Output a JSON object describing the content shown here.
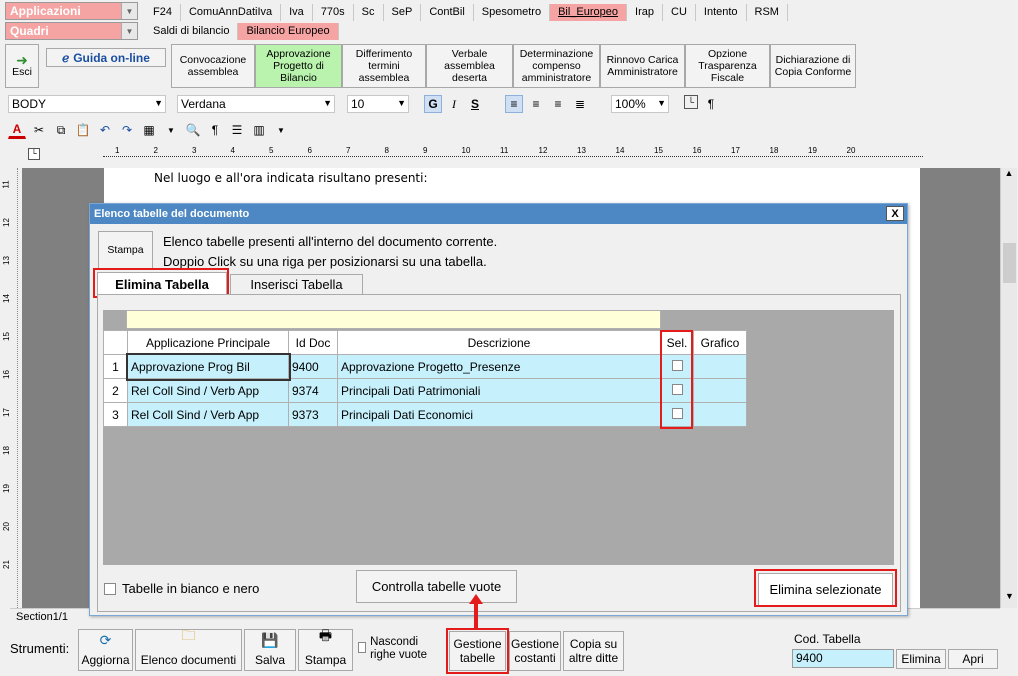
{
  "combos": {
    "applicazioni": "Applicazioni",
    "quadri": "Quadri"
  },
  "app_tabs": [
    "F24",
    "ComuAnnDatiIva",
    "Iva",
    "770s",
    "Sc",
    "SeP",
    "ContBil",
    "Spesometro",
    "Bil_Europeo",
    "Irap",
    "CU",
    "Intento",
    "RSM"
  ],
  "app_tab_selected": "Bil_Europeo",
  "quadri_tabs": [
    "Saldi di bilancio",
    "Bilancio Europeo"
  ],
  "toolbar": {
    "esci": "Esci",
    "guida": "Guida on-line",
    "buttons": [
      {
        "label": "Convocazione assemblea",
        "green": false
      },
      {
        "label": "Approvazione Progetto di Bilancio",
        "green": true
      },
      {
        "label": "Differimento termini assemblea",
        "green": false
      },
      {
        "label": "Verbale assemblea deserta",
        "green": false
      },
      {
        "label": "Determinazione compenso amministratore",
        "green": false
      },
      {
        "label": "Rinnovo Carica Amministratore",
        "green": false
      },
      {
        "label": "Opzione Trasparenza Fiscale",
        "green": false
      },
      {
        "label": "Dichiarazione di Copia Conforme",
        "green": false
      }
    ]
  },
  "format": {
    "style": "BODY",
    "font": "Verdana",
    "size": "10",
    "zoom": "100%",
    "bold": "G",
    "italic": "I",
    "strike": "S"
  },
  "ruler_numbers": [
    "1",
    "2",
    "3",
    "4",
    "5",
    "6",
    "7",
    "8",
    "9",
    "10",
    "11",
    "12",
    "13",
    "14",
    "15",
    "16",
    "17",
    "18",
    "19",
    "20"
  ],
  "vruler_numbers": [
    "11",
    "12",
    "13",
    "14",
    "15",
    "16",
    "17",
    "18",
    "19",
    "20",
    "21"
  ],
  "doc_text": "Nel luogo e all'ora indicata risultano presenti:",
  "dialog": {
    "title": "Elenco tabelle del documento",
    "close": "X",
    "stampa": "Stampa",
    "line1": "Elenco tabelle presenti all'interno del documento corrente.",
    "line2": "Doppio Click su una riga per posizionarsi su una tabella.",
    "tabs": [
      "Elimina Tabella",
      "Inserisci Tabella"
    ],
    "columns": [
      "Applicazione Principale",
      "Id Doc",
      "Descrizione",
      "Sel.",
      "Grafico"
    ],
    "rows": [
      {
        "n": "1",
        "app": "Approvazione Prog Bil",
        "id": "9400",
        "desc": "Approvazione Progetto_Presenze"
      },
      {
        "n": "2",
        "app": "Rel Coll Sind / Verb App",
        "id": "9374",
        "desc": "Principali Dati Patrimoniali"
      },
      {
        "n": "3",
        "app": "Rel Coll Sind / Verb App",
        "id": "9373",
        "desc": "Principali Dati Economici"
      }
    ],
    "bw_label": "Tabelle in bianco e nero",
    "controlla": "Controlla tabelle vuote",
    "elimina": "Elimina selezionate"
  },
  "status": {
    "section": "Section1/1"
  },
  "bottom": {
    "strumenti": "Strumenti:",
    "aggiorna": "Aggiorna",
    "elenco": "Elenco documenti",
    "salva": "Salva",
    "stampa": "Stampa",
    "nascondi": "Nascondi righe vuote",
    "gestione_tabelle": "Gestione tabelle",
    "gestione_costanti": "Gestione costanti",
    "copia": "Copia su altre ditte",
    "cod_label": "Cod. Tabella",
    "cod_value": "9400",
    "elimina": "Elimina",
    "apri": "Apri"
  }
}
